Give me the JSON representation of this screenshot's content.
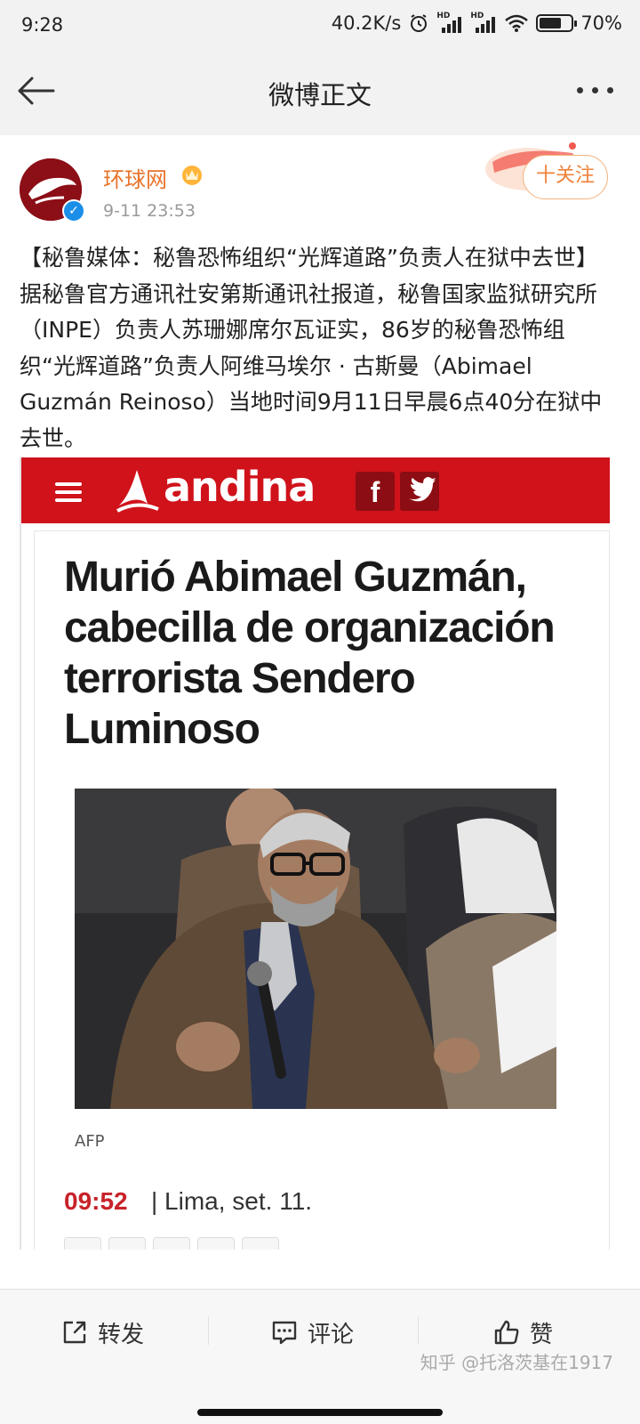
{
  "status_bar": {
    "time": "9:28",
    "net_speed": "40.2K/s",
    "signal_label": "HD",
    "battery": "70%",
    "battery_level": 0.7
  },
  "header": {
    "title": "微博正文"
  },
  "post": {
    "author": "环球网",
    "time": "9-11 23:53",
    "follow_label": "十关注",
    "text": "【秘鲁媒体：秘鲁恐怖组织“光辉道路”负责人在狱中去世】据秘鲁官方通讯社安第斯通讯社报道，秘鲁国家监狱研究所（INPE）负责人苏珊娜席尔瓦证实，86岁的秘鲁恐怖组织“光辉道路”负责人阿维马埃尔 · 古斯曼（Abimael Guzmán Reinoso）当地时间9月11日早晨6点40分在狱中去世。"
  },
  "embed": {
    "site_name": "andina",
    "facebook_glyph": "f",
    "headline": "Murió Abimael Guzmán, cabecilla de organización terrorista Sendero Luminoso",
    "photo_credit": "AFP",
    "article_time": "09:52",
    "article_dateline": "| Lima, set. 11."
  },
  "actions": {
    "repost": "转发",
    "comment": "评论",
    "like": "赞"
  },
  "watermark": "知乎 @托洛茨基在1917",
  "colors": {
    "accent_orange": "#e8732a",
    "andina_red": "#d0121b",
    "verified_blue": "#1b8fe8"
  }
}
